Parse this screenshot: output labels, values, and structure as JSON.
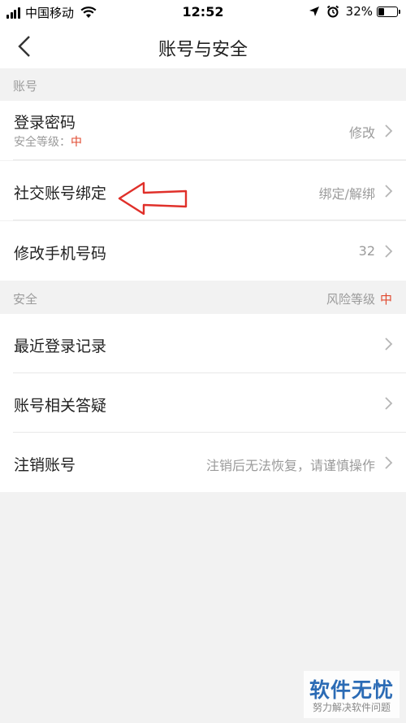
{
  "status_bar": {
    "carrier": "中国移动",
    "time": "12:52",
    "battery": "32%",
    "battery_level": 0.32
  },
  "nav": {
    "title": "账号与安全"
  },
  "account_section": {
    "header": "账号",
    "rows": [
      {
        "title": "登录密码",
        "sub_label": "安全等级：",
        "sub_level": "中",
        "value": "修改"
      },
      {
        "title": "社交账号绑定",
        "value": "绑定/解绑"
      },
      {
        "title": "修改手机号码",
        "value": "32"
      }
    ]
  },
  "security_section": {
    "header": "安全",
    "risk_label": "风险等级",
    "risk_level": "中",
    "rows": [
      {
        "title": "最近登录记录",
        "value": ""
      },
      {
        "title": "账号相关答疑",
        "value": ""
      },
      {
        "title": "注销账号",
        "value": "注销后无法恢复，请谨慎操作"
      }
    ]
  },
  "watermark": {
    "title": "软件无忧",
    "subtitle": "努力解决软件问题"
  },
  "colors": {
    "accent_red": "#e0492f",
    "background": "#f2f2f2",
    "watermark_blue": "#2b6bb5"
  },
  "icons": [
    "signal-icon",
    "wifi-icon",
    "location-arrow-icon",
    "alarm-icon",
    "battery-icon",
    "back-chevron-icon",
    "chevron-right-icon",
    "red-arrow-annotation"
  ]
}
